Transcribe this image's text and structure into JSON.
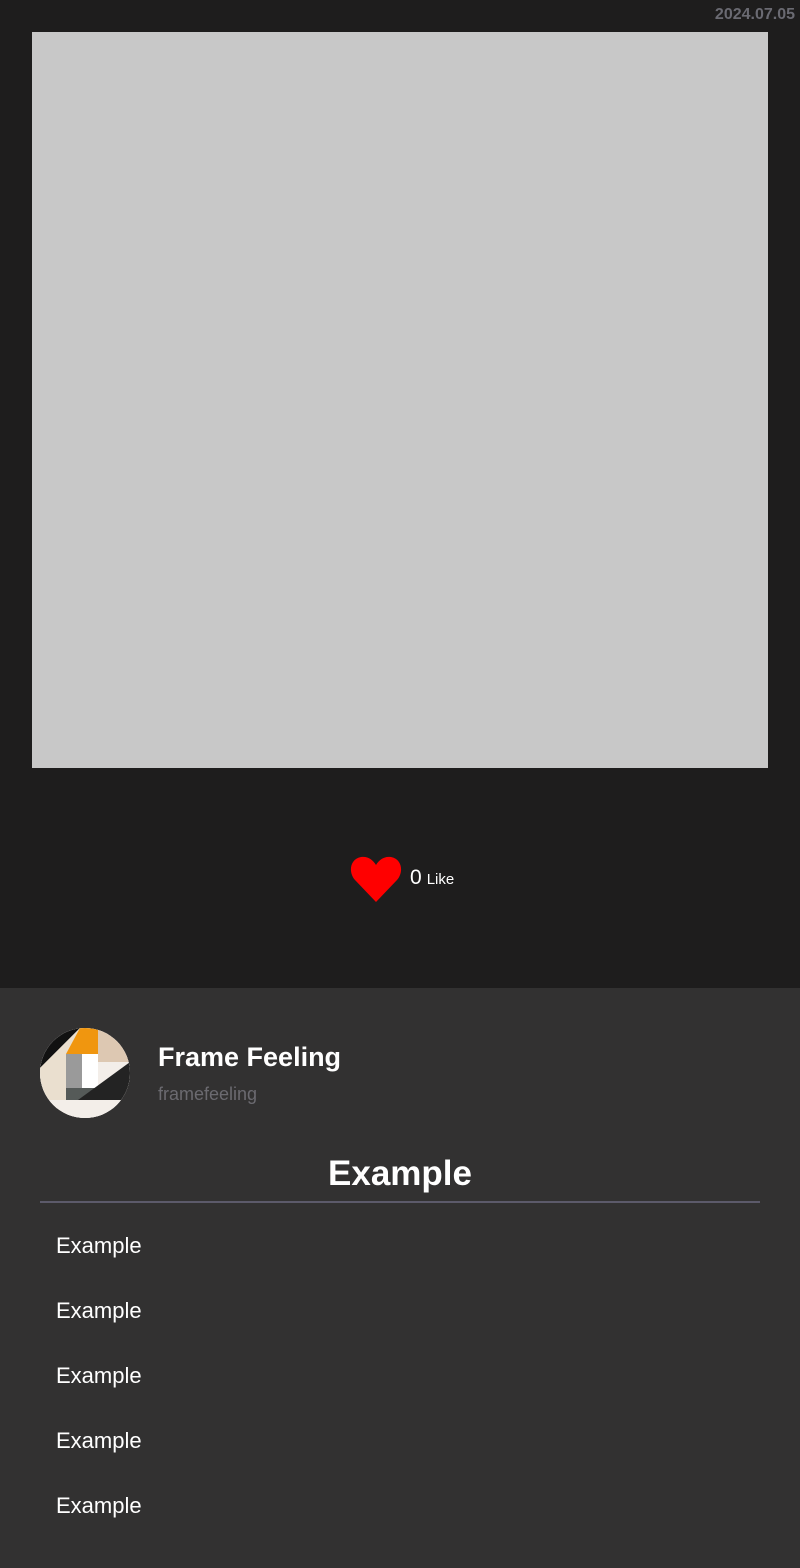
{
  "post": {
    "date": "2024.07.05",
    "like_count": "0",
    "like_label": "Like"
  },
  "profile": {
    "name": "Frame Feeling",
    "handle": "framefeeling"
  },
  "section": {
    "title": "Example",
    "items": [
      {
        "label": "Example"
      },
      {
        "label": "Example"
      },
      {
        "label": "Example"
      },
      {
        "label": "Example"
      },
      {
        "label": "Example"
      }
    ]
  },
  "colors": {
    "background_top": "#1e1d1d",
    "background_bottom": "#323131",
    "image_placeholder": "#c8c8c8",
    "heart": "#ff0000",
    "muted_text": "#6b6a70"
  },
  "icons": {
    "like": "heart-icon",
    "avatar": "abstract-logo-avatar"
  }
}
